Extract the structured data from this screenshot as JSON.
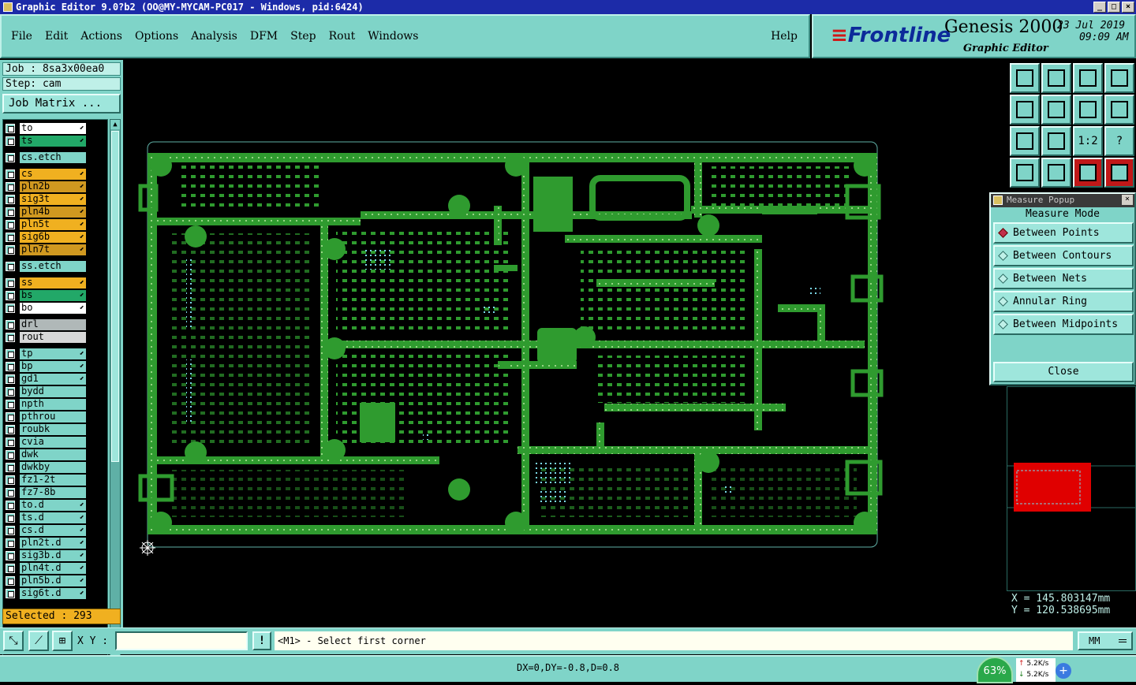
{
  "window": {
    "title": "Graphic Editor 9.0?b2 (OO@MY-MYCAM-PC017 - Windows, pid:6424)"
  },
  "menu": {
    "items": [
      "File",
      "Edit",
      "Actions",
      "Options",
      "Analysis",
      "DFM",
      "Step",
      "Rout",
      "Windows"
    ],
    "help": "Help"
  },
  "brand": {
    "logo": "Frontline",
    "product": "Genesis 2000",
    "subtitle": "Graphic Editor",
    "date": "23 Jul 2019",
    "time": "09:09 AM"
  },
  "job": {
    "job_label": "Job : 8sa3x00ea0",
    "step_label": "Step: cam",
    "matrix_button": "Job Matrix ..."
  },
  "layers": [
    {
      "name": "to",
      "color": "#ffffff",
      "arrow": true
    },
    {
      "name": "ts",
      "color": "#22a868",
      "arrow": true
    },
    {
      "name": "cs.etch",
      "color": "#7fd4c8",
      "arrow": false
    },
    {
      "name": "cs",
      "color": "#f0b020",
      "arrow": true
    },
    {
      "name": "pln2b",
      "color": "#d09820",
      "arrow": true
    },
    {
      "name": "sig3t",
      "color": "#f0b020",
      "arrow": true
    },
    {
      "name": "pln4b",
      "color": "#d09820",
      "arrow": true
    },
    {
      "name": "pln5t",
      "color": "#f0b020",
      "arrow": true
    },
    {
      "name": "sig6b",
      "color": "#f0b020",
      "arrow": true
    },
    {
      "name": "pln7t",
      "color": "#d09820",
      "arrow": true
    },
    {
      "name": "ss.etch",
      "color": "#7fd4c8",
      "arrow": false
    },
    {
      "name": "ss",
      "color": "#f0b020",
      "arrow": true
    },
    {
      "name": "bs",
      "color": "#22a868",
      "arrow": true
    },
    {
      "name": "bo",
      "color": "#ffffff",
      "arrow": true
    },
    {
      "name": "drl",
      "color": "#b0b8b8",
      "arrow": false
    },
    {
      "name": "rout",
      "color": "#d8d8d8",
      "arrow": false
    },
    {
      "name": "tp",
      "color": "#7fd4c8",
      "arrow": true
    },
    {
      "name": "bp",
      "color": "#7fd4c8",
      "arrow": true
    },
    {
      "name": "gd1",
      "color": "#7fd4c8",
      "arrow": true
    },
    {
      "name": "bydd",
      "color": "#7fd4c8",
      "arrow": false
    },
    {
      "name": "npth",
      "color": "#7fd4c8",
      "arrow": false
    },
    {
      "name": "pthrou",
      "color": "#7fd4c8",
      "arrow": false
    },
    {
      "name": "roubk",
      "color": "#7fd4c8",
      "arrow": false
    },
    {
      "name": "cvia",
      "color": "#7fd4c8",
      "arrow": false
    },
    {
      "name": "dwk",
      "color": "#7fd4c8",
      "arrow": false
    },
    {
      "name": "dwkby",
      "color": "#7fd4c8",
      "arrow": false
    },
    {
      "name": "fz1-2t",
      "color": "#7fd4c8",
      "arrow": false
    },
    {
      "name": "fz7-8b",
      "color": "#7fd4c8",
      "arrow": false
    },
    {
      "name": "to.d",
      "color": "#7fd4c8",
      "arrow": true
    },
    {
      "name": "ts.d",
      "color": "#7fd4c8",
      "arrow": true
    },
    {
      "name": "cs.d",
      "color": "#7fd4c8",
      "arrow": true
    },
    {
      "name": "pln2t.d",
      "color": "#7fd4c8",
      "arrow": true
    },
    {
      "name": "sig3b.d",
      "color": "#7fd4c8",
      "arrow": true
    },
    {
      "name": "pln4t.d",
      "color": "#7fd4c8",
      "arrow": true
    },
    {
      "name": "pln5b.d",
      "color": "#7fd4c8",
      "arrow": true
    },
    {
      "name": "sig6t.d",
      "color": "#7fd4c8",
      "arrow": true
    }
  ],
  "selected_label": "Selected : 293",
  "measure_popup": {
    "title": "Measure Popup",
    "mode_label": "Measure Mode",
    "options": [
      "Between Points",
      "Between Contours",
      "Between Nets",
      "Annular Ring",
      "Between Midpoints"
    ],
    "selected_option": "Between Points",
    "close_label": "Close"
  },
  "coords": {
    "x": "X = 145.803147mm",
    "y": "Y = 120.538695mm"
  },
  "status": {
    "xy_label": "X Y :",
    "xy_value": "",
    "prompt": "<M1> - Select first corner",
    "units": "MM",
    "dx_info": "DX=0,DY=-0.8,D=0.8"
  },
  "network": {
    "percent": "63%",
    "up_rate": "5.2K/s",
    "down_rate": "5.2K/s"
  },
  "colors": {
    "copper": "#2f9b2f",
    "panel": "#7fd4c8",
    "accent_red": "#e00000",
    "profile_outline": "#5fb0a6"
  }
}
